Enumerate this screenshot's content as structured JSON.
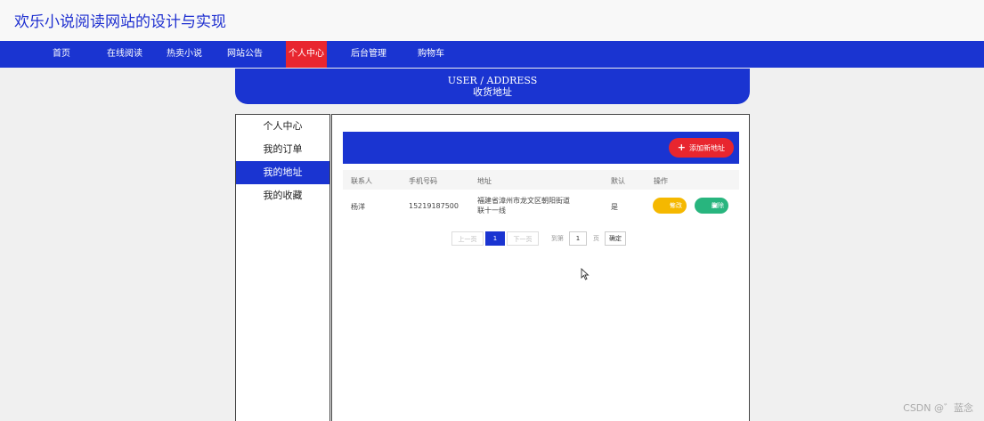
{
  "site": {
    "title": "欢乐小说阅读网站的设计与实现"
  },
  "nav": [
    {
      "label": "首页",
      "active": false
    },
    {
      "label": "在线阅读",
      "active": false
    },
    {
      "label": "热卖小说",
      "active": false
    },
    {
      "label": "网站公告",
      "active": false
    },
    {
      "label": "个人中心",
      "active": true
    },
    {
      "label": "后台管理",
      "active": false
    },
    {
      "label": "购物车",
      "active": false
    }
  ],
  "banner": {
    "en": "USER / ADDRESS",
    "cn": "收货地址"
  },
  "sidebar": [
    {
      "label": "个人中心",
      "active": false
    },
    {
      "label": "我的订单",
      "active": false
    },
    {
      "label": "我的地址",
      "active": true
    },
    {
      "label": "我的收藏",
      "active": false
    }
  ],
  "toolbar": {
    "add_label": "添加新地址"
  },
  "table": {
    "headers": [
      "联系人",
      "手机号码",
      "地址",
      "默认",
      "操作"
    ],
    "rows": [
      {
        "contact": "杨洋",
        "phone": "15219187500",
        "address": "福建省漳州市龙文区朝阳街道联十一线",
        "default": "是"
      }
    ],
    "edit_label": "修改",
    "delete_label": "删除"
  },
  "pager": {
    "prev": "上一页",
    "current": "1",
    "next": "下一页",
    "goto": "到第",
    "page_value": "1",
    "page_unit": "页",
    "confirm": "确定"
  },
  "watermark": "CSDN @゛蓝念",
  "colors": {
    "primary": "#1a34d1",
    "accent": "#e8262f",
    "edit": "#f5b800",
    "delete": "#28b57e"
  }
}
